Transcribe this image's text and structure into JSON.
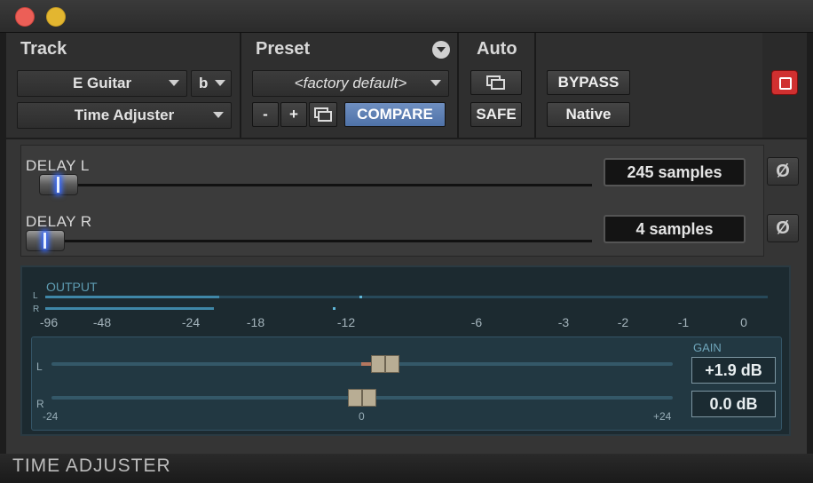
{
  "window": {
    "traffic_lights": [
      "close",
      "minimize"
    ]
  },
  "header": {
    "track": {
      "label": "Track",
      "track_name": "E Guitar",
      "track_sub": "b",
      "plugin_name": "Time Adjuster"
    },
    "preset": {
      "label": "Preset",
      "name": "<factory default>",
      "minus": "-",
      "plus": "+",
      "compare": "COMPARE"
    },
    "auto": {
      "label": "Auto",
      "safe": "SAFE"
    },
    "bypass": "BYPASS",
    "format": "Native"
  },
  "delay": {
    "left": {
      "label": "DELAY L",
      "value": "245 samples",
      "phase_icon": "Ø"
    },
    "right": {
      "label": "DELAY R",
      "value": "4 samples",
      "phase_icon": "Ø"
    }
  },
  "output": {
    "label": "OUTPUT",
    "channel_left": "L",
    "channel_right": "R",
    "scale": [
      "-96",
      "-48",
      "-24",
      "-18",
      "-12",
      "-6",
      "-3",
      "-2",
      "-1",
      "0"
    ],
    "gain": {
      "label": "GAIN",
      "left_value": "+1.9 dB",
      "right_value": "0.0 dB",
      "min": "-24",
      "center": "0",
      "max": "+24"
    }
  },
  "footer": {
    "title": "TIME ADJUSTER"
  },
  "colors": {
    "accent": "#5577aa",
    "power": "#d03030",
    "meter": "#3f87a8"
  }
}
